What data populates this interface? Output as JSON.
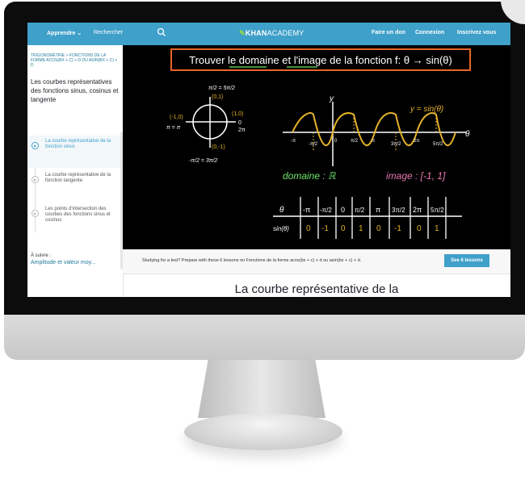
{
  "nav": {
    "learn": "Apprendre",
    "search": "Rechercher",
    "logo_brand": "KHAN",
    "logo_suffix": "ACADEMY",
    "donate": "Faire un don",
    "login": "Connexion",
    "signup": "Inscrivez vous"
  },
  "sidebar": {
    "breadcrumb": "TRIGONOMÉTRIE > FONCTIONS DE LA FORME ACOS(BX + C) + D OU ASIN(BX + C) + D",
    "course_title": "Les courbes représentatives des fonctions sinus, cosinus et tangente",
    "lessons": [
      {
        "label": "La courbe représentative de la fonction sinus"
      },
      {
        "label": "La courbe représentative de la fonction tangente"
      },
      {
        "label": "Les points d'intersection des courbes des fonctions sinus et cosinus"
      }
    ],
    "up_next_label": "À suivre :",
    "up_next_link": "Amplitude et valeur moy..."
  },
  "video": {
    "title": "Trouver le domaine et l'image de la fonction f: θ → sin(θ)",
    "curve_label": "y = sin(θ)",
    "axis_y": "y",
    "axis_x": "θ",
    "circle_labels": [
      "π/2 = 5π/2",
      "(0,1)",
      "(-1,0)",
      "(1,0)",
      "π = π",
      "0",
      "2π",
      "(0,-1)",
      "-π/2 = 3π/2"
    ],
    "tick_labels": [
      "-π",
      "-π/2",
      "0",
      "π/2",
      "π",
      "3π/2",
      "2π",
      "5π/2"
    ],
    "domain_text": "domaine : ℝ",
    "image_text": "image : [-1, 1]",
    "table_header": [
      "θ",
      "-π",
      "-π/2",
      "0",
      "π/2",
      "π",
      "3π/2",
      "2π",
      "5π/2"
    ],
    "table_values": [
      "sin(θ)",
      "0",
      "-1",
      "0",
      "1",
      "0",
      "-1",
      "0",
      "1"
    ]
  },
  "banner": {
    "text": "Studying for a test? Prepare with these 6 lessons on Fonctions de la forme acos(bx + c) + d ou asin(bx + c) + d.",
    "button": "See 6 lessons"
  },
  "page_heading": "La courbe représentative de la",
  "colors": {
    "accent": "#3fa0c9",
    "title_box": "#e8642a",
    "curve": "#e5b32a",
    "green": "#6ee56a",
    "pink": "#e878b0"
  }
}
